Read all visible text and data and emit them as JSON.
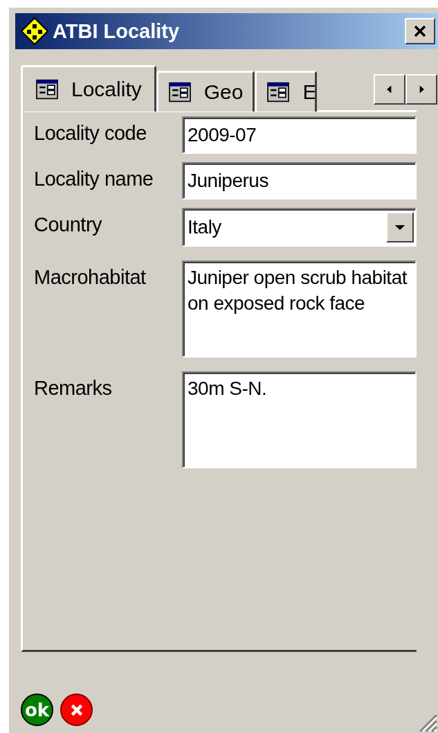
{
  "window": {
    "title": "ATBI Locality"
  },
  "tabs": [
    {
      "label": "Locality",
      "selected": true
    },
    {
      "label": "Geo",
      "selected": false
    },
    {
      "label": "E",
      "selected": false
    }
  ],
  "fields": [
    {
      "label": "Locality code",
      "kind": "text",
      "value": "2009-07"
    },
    {
      "label": "Locality name",
      "kind": "text",
      "value": "Juniperus"
    },
    {
      "label": "Country",
      "kind": "dropdown",
      "value": "Italy"
    },
    {
      "label": "Macrohabitat",
      "kind": "memo",
      "value": "Juniper open scrub habitat on exposed rock face"
    },
    {
      "label": "Remarks",
      "kind": "memo",
      "value": "30m S-N."
    }
  ],
  "buttons": [
    {
      "kind": "ok",
      "label": "ok"
    },
    {
      "kind": "cancel"
    }
  ]
}
